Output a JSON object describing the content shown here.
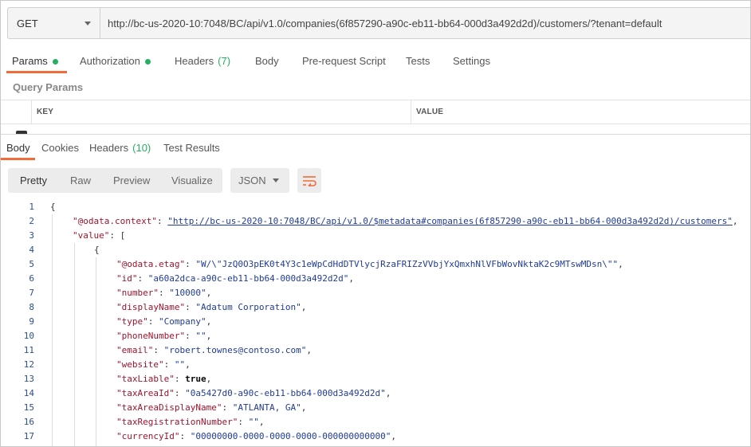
{
  "request": {
    "method": "GET",
    "url": "http://bc-us-2020-10:7048/BC/api/v1.0/companies(6f857290-a90c-eb11-bb64-000d3a492d2d)/customers/?tenant=default"
  },
  "request_tabs": [
    {
      "label": "Params",
      "dot": true
    },
    {
      "label": "Authorization",
      "dot": true
    },
    {
      "label": "Headers",
      "count": "(7)"
    },
    {
      "label": "Body"
    },
    {
      "label": "Pre-request Script"
    },
    {
      "label": "Tests"
    },
    {
      "label": "Settings"
    }
  ],
  "query_params": {
    "title": "Query Params",
    "columns": [
      "KEY",
      "VALUE"
    ]
  },
  "response_tabs": [
    {
      "label": "Body"
    },
    {
      "label": "Cookies"
    },
    {
      "label": "Headers",
      "count": "(10)"
    },
    {
      "label": "Test Results"
    }
  ],
  "format_bar": {
    "options": [
      "Pretty",
      "Raw",
      "Preview",
      "Visualize"
    ],
    "selected": "Pretty",
    "language": "JSON"
  },
  "code_lines": [
    {
      "n": "1",
      "indent": 0,
      "parts": [
        [
          "p",
          "{"
        ]
      ]
    },
    {
      "n": "2",
      "indent": 1,
      "parts": [
        [
          "k",
          "\"@odata.context\""
        ],
        [
          "p",
          ": "
        ],
        [
          "u",
          "\"http://bc-us-2020-10:7048/BC/api/v1.0/$metadata#companies(6f857290-a90c-eb11-bb64-000d3a492d2d)/customers\""
        ],
        [
          "p",
          ","
        ]
      ]
    },
    {
      "n": "3",
      "indent": 1,
      "parts": [
        [
          "k",
          "\"value\""
        ],
        [
          "p",
          ": ["
        ]
      ]
    },
    {
      "n": "4",
      "indent": 2,
      "parts": [
        [
          "p",
          "{"
        ]
      ]
    },
    {
      "n": "5",
      "indent": 3,
      "parts": [
        [
          "k",
          "\"@odata.etag\""
        ],
        [
          "p",
          ": "
        ],
        [
          "s",
          "\"W/\\\"JzQ0O3pEK0t4Y3c1eWpCdHdDTVlycjRzaFRIZzVVbjYxQmxhNlVFbWovNktaK2c9MTswMDsn\\\"\""
        ],
        [
          "p",
          ","
        ]
      ]
    },
    {
      "n": "6",
      "indent": 3,
      "parts": [
        [
          "k",
          "\"id\""
        ],
        [
          "p",
          ": "
        ],
        [
          "s",
          "\"a60a2dca-a90c-eb11-bb64-000d3a492d2d\""
        ],
        [
          "p",
          ","
        ]
      ]
    },
    {
      "n": "7",
      "indent": 3,
      "parts": [
        [
          "k",
          "\"number\""
        ],
        [
          "p",
          ": "
        ],
        [
          "s",
          "\"10000\""
        ],
        [
          "p",
          ","
        ]
      ]
    },
    {
      "n": "8",
      "indent": 3,
      "parts": [
        [
          "k",
          "\"displayName\""
        ],
        [
          "p",
          ": "
        ],
        [
          "s",
          "\"Adatum Corporation\""
        ],
        [
          "p",
          ","
        ]
      ]
    },
    {
      "n": "9",
      "indent": 3,
      "parts": [
        [
          "k",
          "\"type\""
        ],
        [
          "p",
          ": "
        ],
        [
          "s",
          "\"Company\""
        ],
        [
          "p",
          ","
        ]
      ]
    },
    {
      "n": "10",
      "indent": 3,
      "parts": [
        [
          "k",
          "\"phoneNumber\""
        ],
        [
          "p",
          ": "
        ],
        [
          "s",
          "\"\""
        ],
        [
          "p",
          ","
        ]
      ]
    },
    {
      "n": "11",
      "indent": 3,
      "parts": [
        [
          "k",
          "\"email\""
        ],
        [
          "p",
          ": "
        ],
        [
          "s",
          "\"robert.townes@contoso.com\""
        ],
        [
          "p",
          ","
        ]
      ]
    },
    {
      "n": "12",
      "indent": 3,
      "parts": [
        [
          "k",
          "\"website\""
        ],
        [
          "p",
          ": "
        ],
        [
          "s",
          "\"\""
        ],
        [
          "p",
          ","
        ]
      ]
    },
    {
      "n": "13",
      "indent": 3,
      "parts": [
        [
          "k",
          "\"taxLiable\""
        ],
        [
          "p",
          ": "
        ],
        [
          "b",
          "true"
        ],
        [
          "p",
          ","
        ]
      ]
    },
    {
      "n": "14",
      "indent": 3,
      "parts": [
        [
          "k",
          "\"taxAreaId\""
        ],
        [
          "p",
          ": "
        ],
        [
          "s",
          "\"0a5427d0-a90c-eb11-bb64-000d3a492d2d\""
        ],
        [
          "p",
          ","
        ]
      ]
    },
    {
      "n": "15",
      "indent": 3,
      "parts": [
        [
          "k",
          "\"taxAreaDisplayName\""
        ],
        [
          "p",
          ": "
        ],
        [
          "s",
          "\"ATLANTA, GA\""
        ],
        [
          "p",
          ","
        ]
      ]
    },
    {
      "n": "16",
      "indent": 3,
      "parts": [
        [
          "k",
          "\"taxRegistrationNumber\""
        ],
        [
          "p",
          ": "
        ],
        [
          "s",
          "\"\""
        ],
        [
          "p",
          ","
        ]
      ]
    },
    {
      "n": "17",
      "indent": 3,
      "parts": [
        [
          "k",
          "\"currencyId\""
        ],
        [
          "p",
          ": "
        ],
        [
          "s",
          "\"00000000-0000-0000-0000-000000000000\""
        ],
        [
          "p",
          ","
        ]
      ]
    }
  ],
  "colors": {
    "accent": "#f26b3a",
    "status_green": "#27ae60",
    "json_key": "#a3122a",
    "json_string": "#1f3b9c"
  }
}
